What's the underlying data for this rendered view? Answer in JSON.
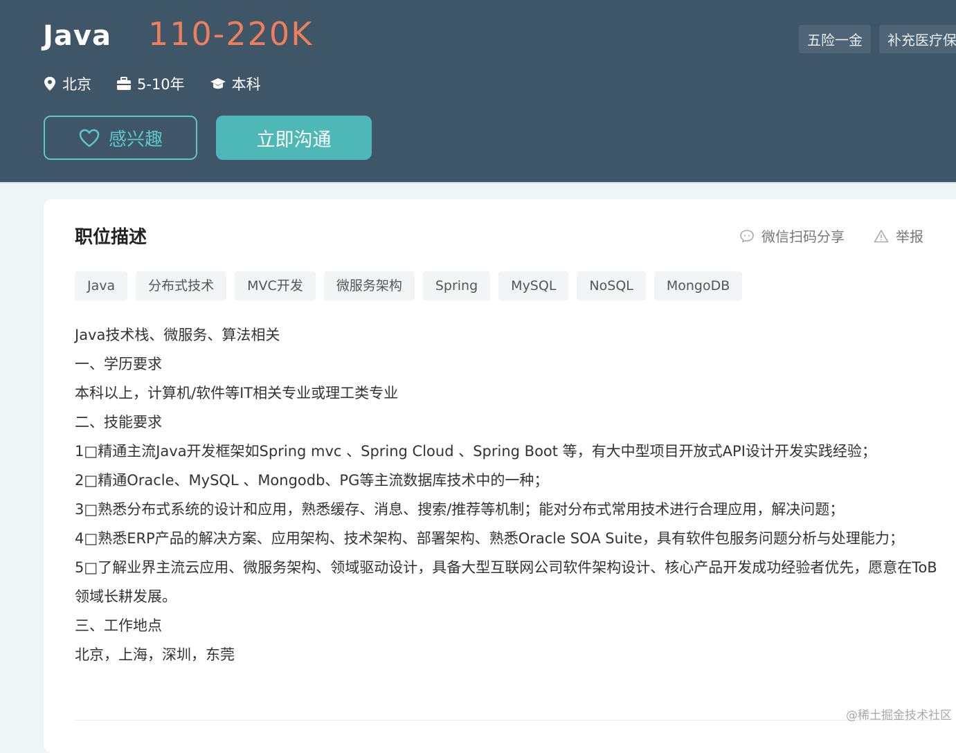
{
  "header": {
    "title": "Java",
    "salary": "110-220K",
    "benefits": [
      "五险一金",
      "补充医疗保"
    ],
    "meta": {
      "city": "北京",
      "experience": "5-10年",
      "degree": "本科"
    },
    "interest_label": "感兴趣",
    "chat_label": "立即沟通"
  },
  "card": {
    "section_title": "职位描述",
    "share_label": "微信扫码分享",
    "report_label": "举报",
    "skills": [
      "Java",
      "分布式技术",
      "MVC开发",
      "微服务架构",
      "Spring",
      "MySQL",
      "NoSQL",
      "MongoDB"
    ],
    "description": [
      "Java技术栈、微服务、算法相关",
      "一、学历要求",
      "本科以上，计算机/软件等IT相关专业或理工类专业",
      "二、技能要求",
      "1□精通主流Java开发框架如Spring mvc 、Spring Cloud 、Spring Boot 等，有大中型项目开放式API设计开发实践经验；",
      "2□精通Oracle、MySQL 、Mongodb、PG等主流数据库技术中的一种；",
      "3□熟悉分布式系统的设计和应用，熟悉缓存、消息、搜索/推荐等机制；能对分布式常用技术进行合理应用，解决问题；",
      "4□熟悉ERP产品的解决方案、应用架构、技术架构、部署架构、熟悉Oracle SOA Suite，具有软件包服务问题分析与处理能力；",
      "5□了解业界主流云应用、微服务架构、领域驱动设计，具备大型互联网公司软件架构设计、核心产品开发成功经验者优先，愿意在ToB领域长耕发展。",
      "三、工作地点",
      "北京，上海，深圳，东莞"
    ]
  },
  "watermark": "@稀土掘金技术社区",
  "colors": {
    "banner": "#3f5568",
    "salary": "#ee7f5c",
    "accent": "#4db8b6"
  }
}
